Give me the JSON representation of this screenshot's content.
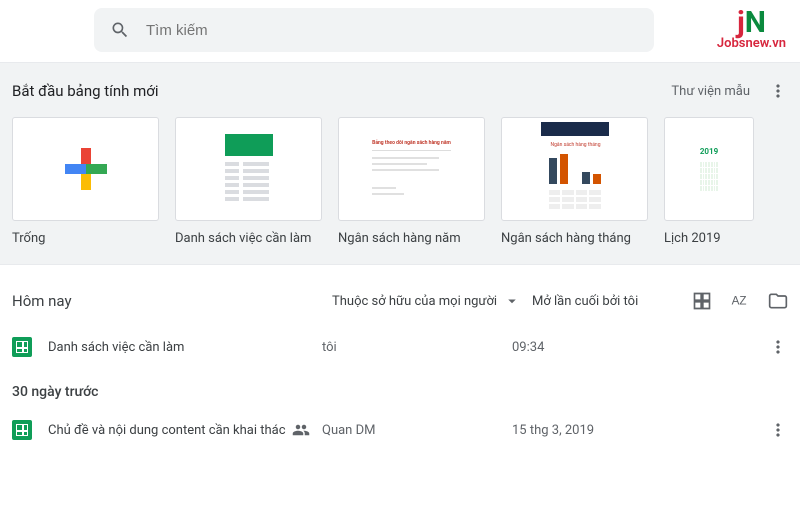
{
  "search": {
    "placeholder": "Tìm kiếm"
  },
  "watermark": {
    "logo_j": "j",
    "logo_n": "N",
    "text": "Jobsnew.vn"
  },
  "templates": {
    "title": "Bắt đầu bảng tính mới",
    "gallery": "Thư viện mẫu",
    "items": [
      {
        "label": "Trống"
      },
      {
        "label": "Danh sách việc cần làm"
      },
      {
        "label": "Ngân sách hàng năm"
      },
      {
        "label": "Ngân sách hàng tháng"
      },
      {
        "label": "Lịch 2019"
      }
    ],
    "annual_title": "Bảng theo dõi ngân sách hàng năm",
    "monthly_title": "Ngân sách hàng tháng",
    "cal_year": "2019"
  },
  "docs": {
    "header": {
      "today": "Hôm nay",
      "owner_filter": "Thuộc sở hữu của mọi người",
      "date_header": "Mở lần cuối bởi tôi"
    },
    "sections": {
      "today": {
        "label": "Hôm nay",
        "rows": [
          {
            "name": "Danh sách việc cần làm",
            "owner": "tôi",
            "date": "09:34",
            "shared": false
          }
        ]
      },
      "older": {
        "label": "30 ngày trước",
        "rows": [
          {
            "name": "Chủ đề và nội dung content cần khai thác",
            "owner": "Quan DM",
            "date": "15 thg 3, 2019",
            "shared": true
          }
        ]
      }
    }
  }
}
